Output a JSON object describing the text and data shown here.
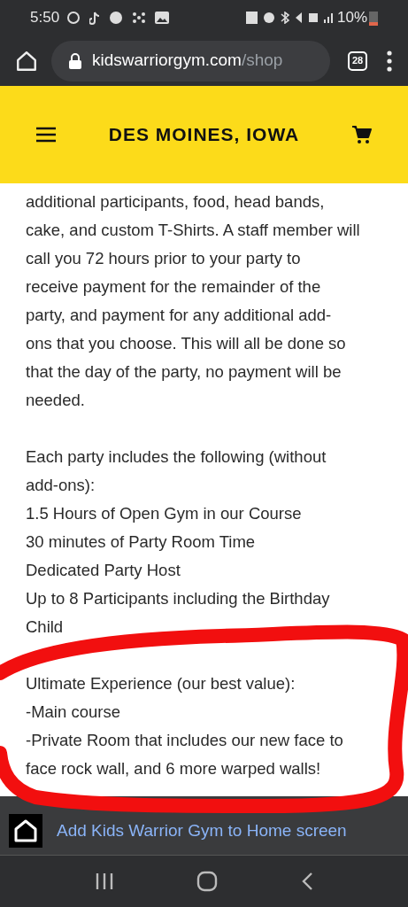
{
  "status_bar": {
    "time": "5:50",
    "battery": "10%"
  },
  "browser": {
    "url_host": "kidswarriorgym.com",
    "url_path": "/shop",
    "tab_count": "28"
  },
  "site_header": {
    "title": "DES MOINES, IOWA"
  },
  "paragraphs": [
    {
      "lines": [
        "additional participants, food, head bands,",
        "cake, and custom T-Shirts. A staff member will",
        "call you 72 hours prior to your party to",
        "receive payment for the remainder of the",
        "party, and payment for any additional add-",
        "ons that you choose. This will all be done so",
        "that the day of the party, no payment will be",
        "needed."
      ]
    },
    {
      "lines": [
        "Each party includes the following (without",
        "add-ons):",
        "1.5 Hours of Open Gym in our Course",
        "30 minutes of Party Room Time",
        "Dedicated Party Host",
        "Up to 8 Participants including the Birthday",
        "Child"
      ]
    },
    {
      "lines": [
        "Ultimate Experience (our best value):",
        "-Main course",
        "-Private Room that includes our new face to",
        "face rock wall, and 6 more warped walls!"
      ]
    }
  ],
  "install_banner": {
    "text": "Add Kids Warrior Gym to Home screen"
  }
}
